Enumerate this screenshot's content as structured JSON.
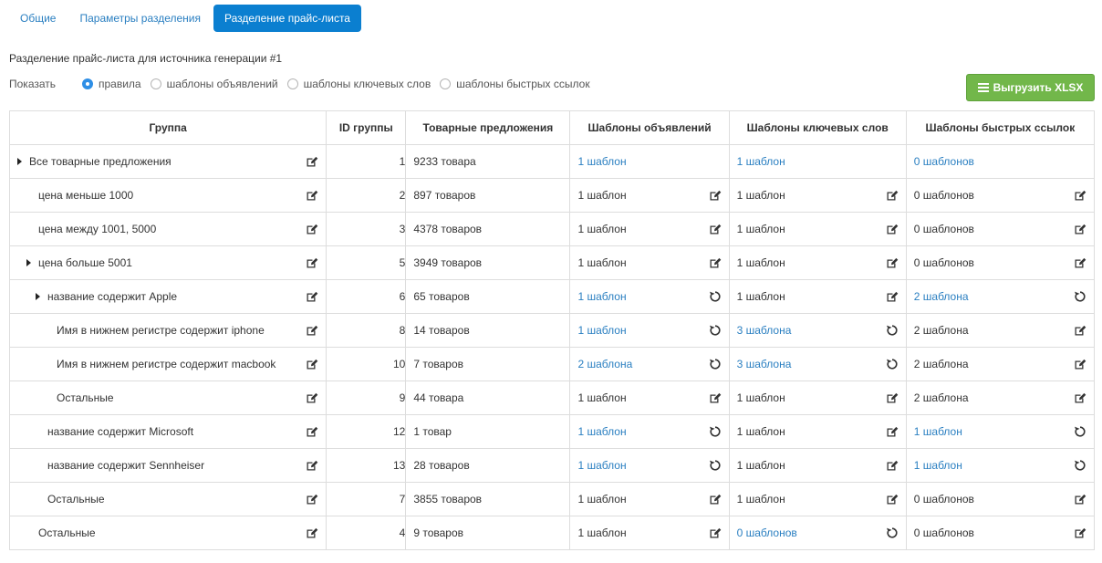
{
  "tabs": [
    {
      "label": "Общие",
      "active": false
    },
    {
      "label": "Параметры разделения",
      "active": false
    },
    {
      "label": "Разделение прайс-листа",
      "active": true
    }
  ],
  "subtitle": "Разделение прайс-листа для источника генерации #1",
  "show": {
    "label": "Показать",
    "options": [
      {
        "label": "правила",
        "checked": true
      },
      {
        "label": "шаблоны объявлений",
        "checked": false
      },
      {
        "label": "шаблоны ключевых слов",
        "checked": false
      },
      {
        "label": "шаблоны быстрых ссылок",
        "checked": false
      }
    ]
  },
  "export_button": "Выгрузить XLSX",
  "colors": {
    "accent": "#0b7fd0",
    "link": "#2a7fc1",
    "export": "#72b74a"
  },
  "table": {
    "headers": [
      "Группа",
      "ID группы",
      "Товарные предложения",
      "Шаблоны объявлений",
      "Шаблоны ключевых слов",
      "Шаблоны быстрых ссылок"
    ],
    "rows": [
      {
        "group": "Все товарные предложения",
        "level": 0,
        "caret": true,
        "id": "1",
        "offers": "9233 товара",
        "ads": {
          "text": "1 шаблон",
          "link": true,
          "icon": "none"
        },
        "keywords": {
          "text": "1 шаблон",
          "link": true,
          "icon": "none"
        },
        "quicklinks": {
          "text": "0 шаблонов",
          "link": true,
          "icon": "none"
        }
      },
      {
        "group": "цена меньше 1000",
        "level": 1,
        "caret": false,
        "id": "2",
        "offers": "897 товаров",
        "ads": {
          "text": "1 шаблон",
          "link": false,
          "icon": "edit-icon"
        },
        "keywords": {
          "text": "1 шаблон",
          "link": false,
          "icon": "edit-icon"
        },
        "quicklinks": {
          "text": "0 шаблонов",
          "link": false,
          "icon": "edit-icon"
        }
      },
      {
        "group": "цена между 1001, 5000",
        "level": 1,
        "caret": false,
        "id": "3",
        "offers": "4378 товаров",
        "ads": {
          "text": "1 шаблон",
          "link": false,
          "icon": "edit-icon"
        },
        "keywords": {
          "text": "1 шаблон",
          "link": false,
          "icon": "edit-icon"
        },
        "quicklinks": {
          "text": "0 шаблонов",
          "link": false,
          "icon": "edit-icon"
        }
      },
      {
        "group": "цена больше 5001",
        "level": 1,
        "caret": true,
        "id": "5",
        "offers": "3949 товаров",
        "ads": {
          "text": "1 шаблон",
          "link": false,
          "icon": "edit-icon"
        },
        "keywords": {
          "text": "1 шаблон",
          "link": false,
          "icon": "edit-icon"
        },
        "quicklinks": {
          "text": "0 шаблонов",
          "link": false,
          "icon": "edit-icon"
        }
      },
      {
        "group": "название содержит Apple",
        "level": 2,
        "caret": true,
        "id": "6",
        "offers": "65 товаров",
        "ads": {
          "text": "1 шаблон",
          "link": true,
          "icon": "reset-icon"
        },
        "keywords": {
          "text": "1 шаблон",
          "link": false,
          "icon": "edit-icon"
        },
        "quicklinks": {
          "text": "2 шаблона",
          "link": true,
          "icon": "reset-icon"
        }
      },
      {
        "group": "Имя в нижнем регистре содержит iphone",
        "level": 3,
        "caret": false,
        "id": "8",
        "offers": "14 товаров",
        "ads": {
          "text": "1 шаблон",
          "link": true,
          "icon": "reset-icon"
        },
        "keywords": {
          "text": "3 шаблона",
          "link": true,
          "icon": "reset-icon"
        },
        "quicklinks": {
          "text": "2 шаблона",
          "link": false,
          "icon": "edit-icon"
        }
      },
      {
        "group": "Имя в нижнем регистре содержит macbook",
        "level": 3,
        "caret": false,
        "id": "10",
        "offers": "7 товаров",
        "ads": {
          "text": "2 шаблона",
          "link": true,
          "icon": "reset-icon"
        },
        "keywords": {
          "text": "3 шаблона",
          "link": true,
          "icon": "reset-icon"
        },
        "quicklinks": {
          "text": "2 шаблона",
          "link": false,
          "icon": "edit-icon"
        }
      },
      {
        "group": "Остальные",
        "level": 3,
        "caret": false,
        "id": "9",
        "offers": "44 товара",
        "ads": {
          "text": "1 шаблон",
          "link": false,
          "icon": "edit-icon"
        },
        "keywords": {
          "text": "1 шаблон",
          "link": false,
          "icon": "edit-icon"
        },
        "quicklinks": {
          "text": "2 шаблона",
          "link": false,
          "icon": "edit-icon"
        }
      },
      {
        "group": "название содержит Microsoft",
        "level": 2,
        "caret": false,
        "id": "12",
        "offers": "1 товар",
        "ads": {
          "text": "1 шаблон",
          "link": true,
          "icon": "reset-icon"
        },
        "keywords": {
          "text": "1 шаблон",
          "link": false,
          "icon": "edit-icon"
        },
        "quicklinks": {
          "text": "1 шаблон",
          "link": true,
          "icon": "reset-icon"
        }
      },
      {
        "group": "название содержит Sennheiser",
        "level": 2,
        "caret": false,
        "id": "13",
        "offers": "28 товаров",
        "ads": {
          "text": "1 шаблон",
          "link": true,
          "icon": "reset-icon"
        },
        "keywords": {
          "text": "1 шаблон",
          "link": false,
          "icon": "edit-icon"
        },
        "quicklinks": {
          "text": "1 шаблон",
          "link": true,
          "icon": "reset-icon"
        }
      },
      {
        "group": "Остальные",
        "level": 2,
        "caret": false,
        "id": "7",
        "offers": "3855 товаров",
        "ads": {
          "text": "1 шаблон",
          "link": false,
          "icon": "edit-icon"
        },
        "keywords": {
          "text": "1 шаблон",
          "link": false,
          "icon": "edit-icon"
        },
        "quicklinks": {
          "text": "0 шаблонов",
          "link": false,
          "icon": "edit-icon"
        }
      },
      {
        "group": "Остальные",
        "level": 1,
        "caret": false,
        "id": "4",
        "offers": "9 товаров",
        "ads": {
          "text": "1 шаблон",
          "link": false,
          "icon": "edit-icon"
        },
        "keywords": {
          "text": "0 шаблонов",
          "link": true,
          "icon": "reset-icon"
        },
        "quicklinks": {
          "text": "0 шаблонов",
          "link": false,
          "icon": "edit-icon"
        }
      }
    ]
  }
}
